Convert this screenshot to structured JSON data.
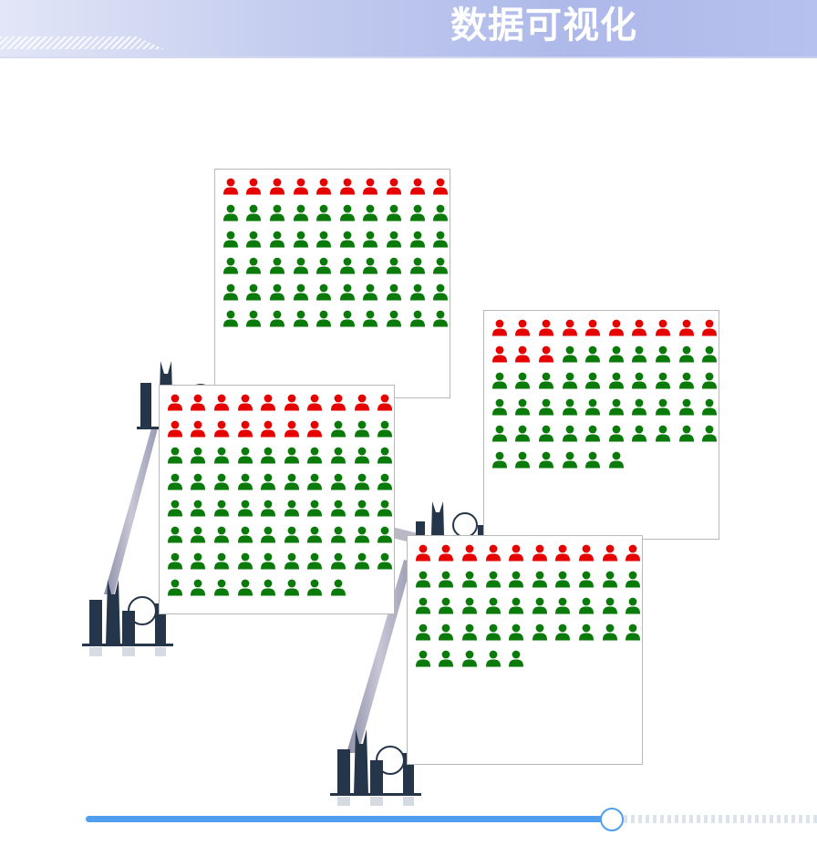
{
  "header": {
    "title": "数据可视化"
  },
  "colors": {
    "highlight": "#e60000",
    "base": "#0a7a0a",
    "track": "#4f9ef0"
  },
  "panels": [
    {
      "name": "panel-1",
      "total": 60,
      "highlighted": 10
    },
    {
      "name": "panel-2",
      "total": 78,
      "highlighted": 17
    },
    {
      "name": "panel-3",
      "total": 56,
      "highlighted": 13
    },
    {
      "name": "panel-4",
      "total": 45,
      "highlighted": 10
    }
  ],
  "icons": {
    "person": "person-icon",
    "city": "city-skyline-icon"
  },
  "timeline": {
    "progress": 0.78
  }
}
